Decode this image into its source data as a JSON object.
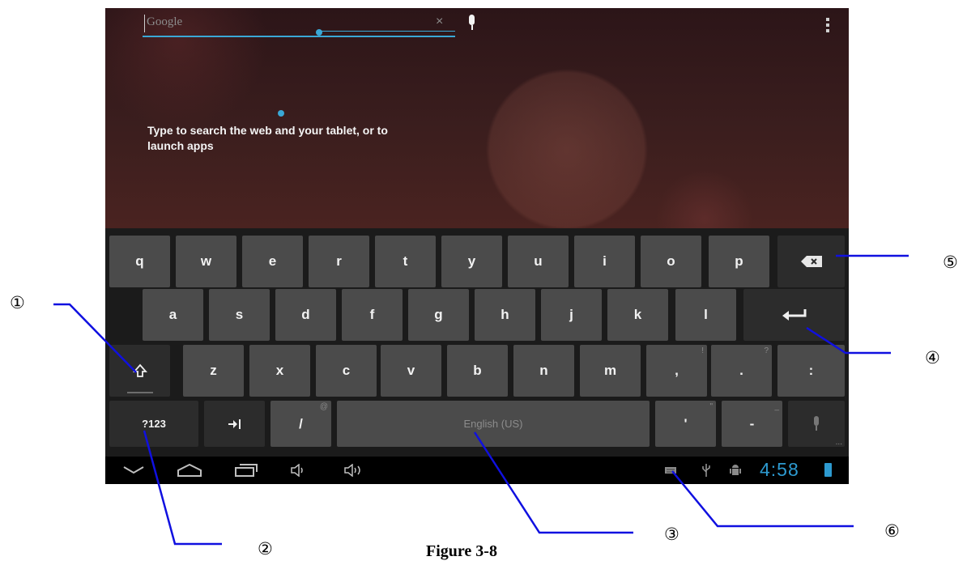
{
  "search": {
    "hint": "Google",
    "clear_glyph": "×"
  },
  "hint_text": "Type to search the web and your tablet, or to launch apps",
  "keys": {
    "row1": [
      "q",
      "w",
      "e",
      "r",
      "t",
      "y",
      "u",
      "i",
      "o",
      "p"
    ],
    "row2": [
      "a",
      "s",
      "d",
      "f",
      "g",
      "h",
      "j",
      "k",
      "l"
    ],
    "row3": [
      "z",
      "x",
      "c",
      "v",
      "b",
      "n",
      "m"
    ],
    "comma": ",",
    "comma_hint": "!",
    "period": ".",
    "period_hint": "?",
    "colon": ":",
    "sym": "?123",
    "slash": "/",
    "slash_hint": "@",
    "space": "English (US)",
    "apostrophe": "'",
    "apostrophe_hint": "\"",
    "dash": "-",
    "dash_hint": "_",
    "mic_hint": "..."
  },
  "icons": {
    "backspace": "backspace-icon",
    "enter": "enter-icon",
    "shift": "shift-icon",
    "tab": "tab-icon",
    "mic": "mic-icon"
  },
  "status": {
    "time": "4:58"
  },
  "annotations": {
    "n1": "①",
    "n2": "②",
    "n3": "③",
    "n4": "④",
    "n5": "⑤",
    "n6": "⑥"
  },
  "caption": "Figure 3-8",
  "colors": {
    "accent": "#3aa8d6",
    "annotation": "#1010e0",
    "key": "#4b4b4b",
    "key_dark": "#2c2c2c"
  }
}
